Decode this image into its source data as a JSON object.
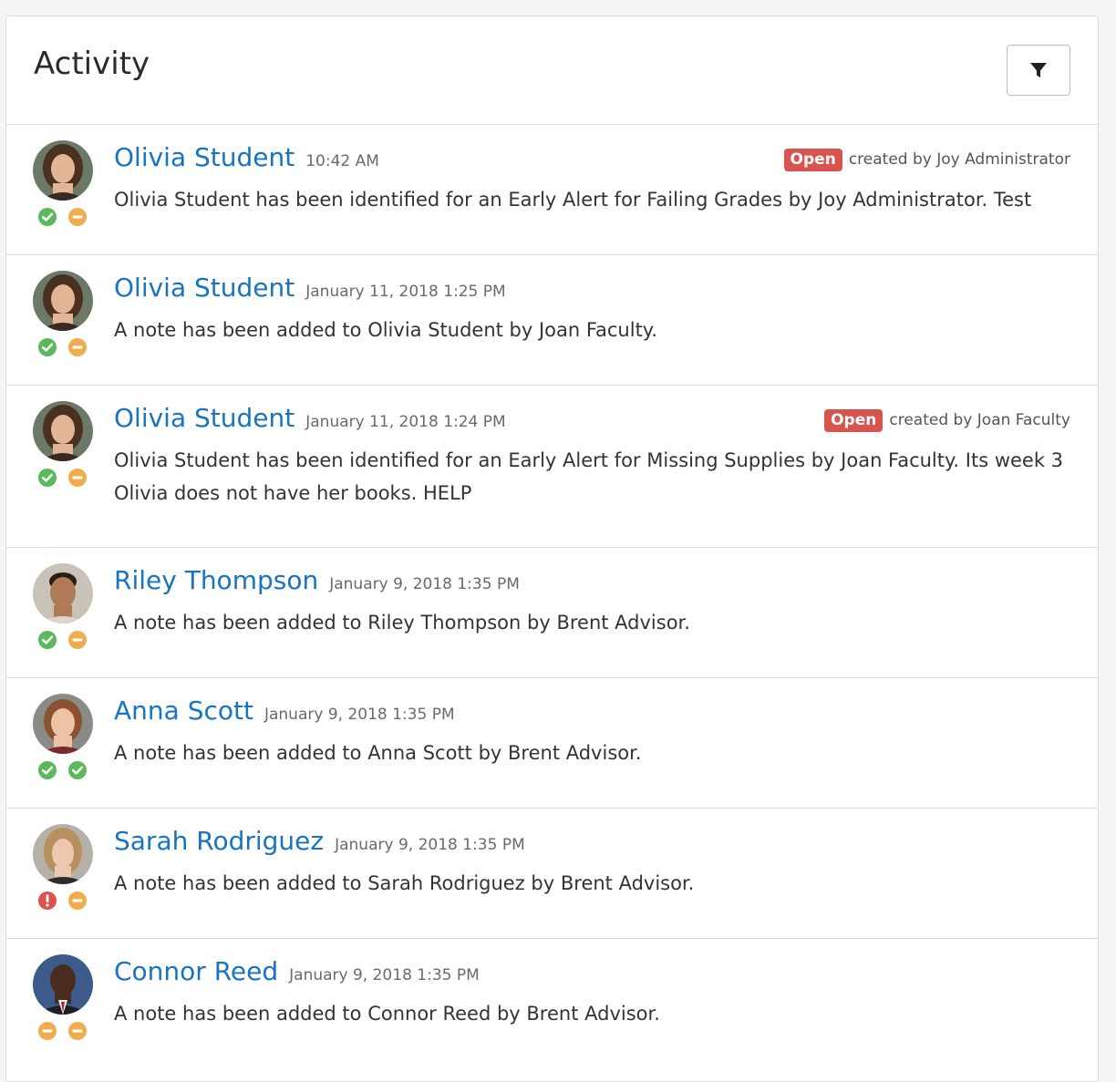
{
  "header": {
    "title": "Activity",
    "filter_icon": "filter-icon"
  },
  "colors": {
    "link": "#1874c1",
    "badge_open": "#d9534f",
    "status_ok": "#5cb85c",
    "status_neutral": "#f0ad4e",
    "status_alert": "#d9534f"
  },
  "activities": [
    {
      "name": "Olivia Student",
      "time": "10:42 AM",
      "badge": "Open",
      "created_by": "created by Joy Administrator",
      "description": "Olivia Student has been identified for an Early Alert for Failing Grades by Joy Administrator. Test",
      "status": [
        "check",
        "minus"
      ]
    },
    {
      "name": "Olivia Student",
      "time": "January 11, 2018 1:25 PM",
      "description": "A note has been added to Olivia Student by Joan Faculty.",
      "status": [
        "check",
        "minus"
      ]
    },
    {
      "name": "Olivia Student",
      "time": "January 11, 2018 1:24 PM",
      "badge": "Open",
      "created_by": "created by Joan Faculty",
      "description": "Olivia Student has been identified for an Early Alert for Missing Supplies by Joan Faculty. Its week 3 Olivia does not have her books. HELP",
      "status": [
        "check",
        "minus"
      ]
    },
    {
      "name": "Riley Thompson",
      "time": "January 9, 2018 1:35 PM",
      "description": "A note has been added to Riley Thompson by Brent Advisor.",
      "status": [
        "check",
        "minus"
      ]
    },
    {
      "name": "Anna Scott",
      "time": "January 9, 2018 1:35 PM",
      "description": "A note has been added to Anna Scott by Brent Advisor.",
      "status": [
        "check",
        "check"
      ]
    },
    {
      "name": "Sarah Rodriguez",
      "time": "January 9, 2018 1:35 PM",
      "description": "A note has been added to Sarah Rodriguez by Brent Advisor.",
      "status": [
        "alert",
        "minus"
      ]
    },
    {
      "name": "Connor Reed",
      "time": "January 9, 2018 1:35 PM",
      "description": "A note has been added to Connor Reed by Brent Advisor.",
      "status": [
        "minus",
        "minus"
      ]
    }
  ]
}
